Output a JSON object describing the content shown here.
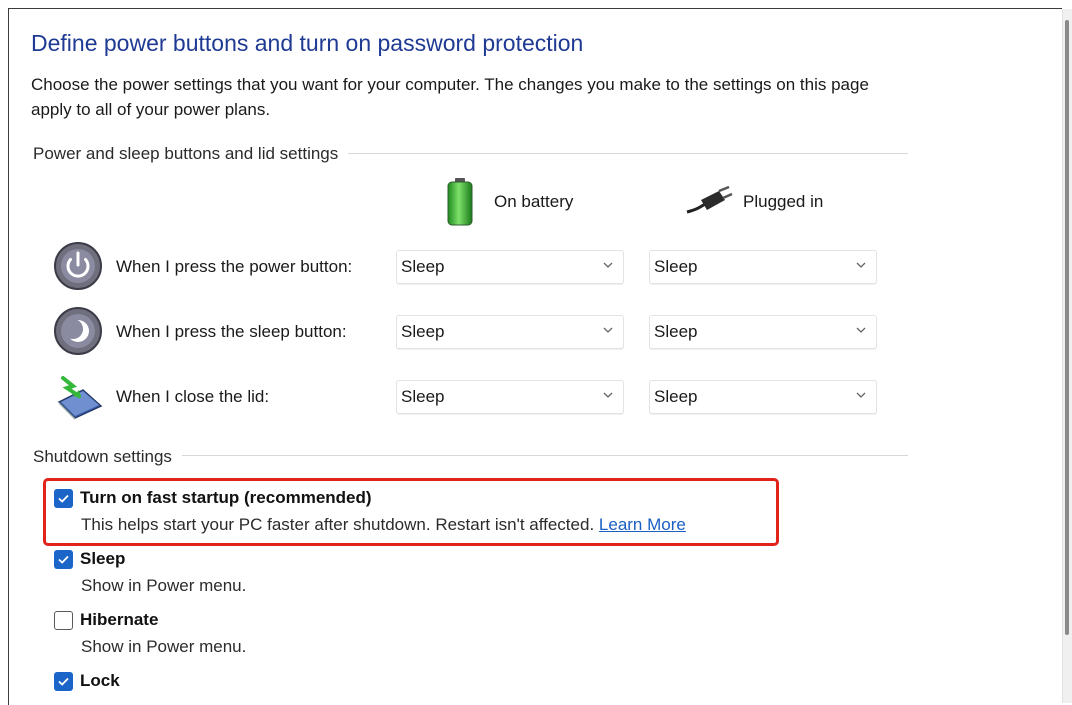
{
  "page": {
    "title": "Define power buttons and turn on password protection",
    "description": "Choose the power settings that you want for your computer. The changes you make to the settings on this page apply to all of your power plans."
  },
  "power_section": {
    "label": "Power and sleep buttons and lid settings",
    "columns": [
      {
        "label": "On battery",
        "icon": "battery-icon"
      },
      {
        "label": "Plugged in",
        "icon": "power-plug-icon"
      }
    ],
    "rows": [
      {
        "label": "When I press the power button:",
        "icon": "power-button-icon",
        "on_battery": "Sleep",
        "plugged_in": "Sleep"
      },
      {
        "label": "When I press the sleep button:",
        "icon": "sleep-button-icon",
        "on_battery": "Sleep",
        "plugged_in": "Sleep"
      },
      {
        "label": "When I close the lid:",
        "icon": "laptop-lid-icon",
        "on_battery": "Sleep",
        "plugged_in": "Sleep"
      }
    ]
  },
  "shutdown_section": {
    "label": "Shutdown settings",
    "options": [
      {
        "label": "Turn on fast startup (recommended)",
        "checked": true,
        "description": "This helps start your PC faster after shutdown. Restart isn't affected.",
        "link": "Learn More"
      },
      {
        "label": "Sleep",
        "checked": true,
        "description": "Show in Power menu."
      },
      {
        "label": "Hibernate",
        "checked": false,
        "description": "Show in Power menu."
      },
      {
        "label": "Lock",
        "checked": true
      }
    ]
  },
  "colors": {
    "title": "#1f3a93",
    "checkbox_checked": "#1b64c8",
    "highlight_border": "#e2231a",
    "link": "#1a5fc4"
  }
}
